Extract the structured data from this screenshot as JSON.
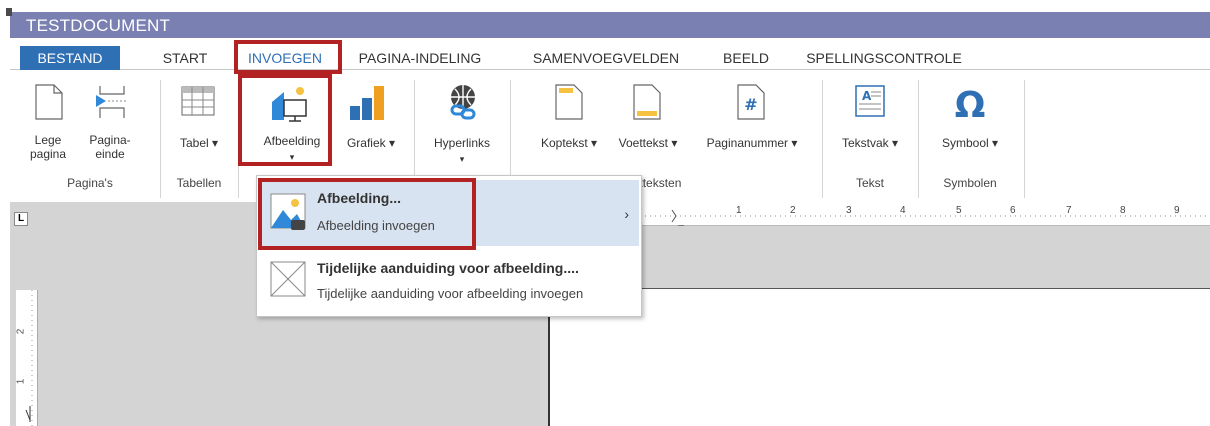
{
  "window": {
    "title": "TESTDOCUMENT"
  },
  "tabs": [
    {
      "label": "BESTAND",
      "active": true
    },
    {
      "label": "START"
    },
    {
      "label": "INVOEGEN",
      "highlighted": true
    },
    {
      "label": "PAGINA-INDELING"
    },
    {
      "label": "SAMENVOEGVELDEN"
    },
    {
      "label": "BEELD"
    },
    {
      "label": "SPELLINGSCONTROLE"
    }
  ],
  "ribbon": {
    "groups": {
      "paginas": "Pagina's",
      "tabellen": "Tabellen",
      "kop_voet_partial": "n voetteksten",
      "tekst": "Tekst",
      "symbolen": "Symbolen"
    },
    "buttons": {
      "lege_pagina_1": "Lege",
      "lege_pagina_2": "pagina",
      "pagina_einde_1": "Pagina-",
      "pagina_einde_2": "einde",
      "tabel": "Tabel ▾",
      "afbeelding": "Afbeelding",
      "grafiek": "Grafiek ▾",
      "hyperlinks": "Hyperlinks",
      "koptekst": "Koptekst ▾",
      "voettekst": "Voettekst ▾",
      "paginanummer": "Paginanummer ▾",
      "tekstvak": "Tekstvak ▾",
      "symbool": "Symbool ▾"
    },
    "caret": "▾"
  },
  "dropdown": {
    "items": [
      {
        "title": "Afbeelding...",
        "subtitle": "Afbeelding invoegen",
        "has_submenu": true
      },
      {
        "title": "Tijdelijke aanduiding voor afbeelding....",
        "subtitle": "Tijdelijke aanduiding voor afbeelding invoegen"
      }
    ],
    "chevron": "›"
  },
  "ruler": {
    "corner": "L",
    "h_numbers": [
      "1",
      "2",
      "3",
      "4",
      "5",
      "6",
      "7",
      "8",
      "9"
    ],
    "v_numbers": [
      "2",
      "1"
    ]
  },
  "colors": {
    "titlebar": "#7b80b3",
    "active_tab": "#2f6fb4",
    "highlight_box": "#b22222",
    "menu_highlight": "#d8e3f1"
  }
}
